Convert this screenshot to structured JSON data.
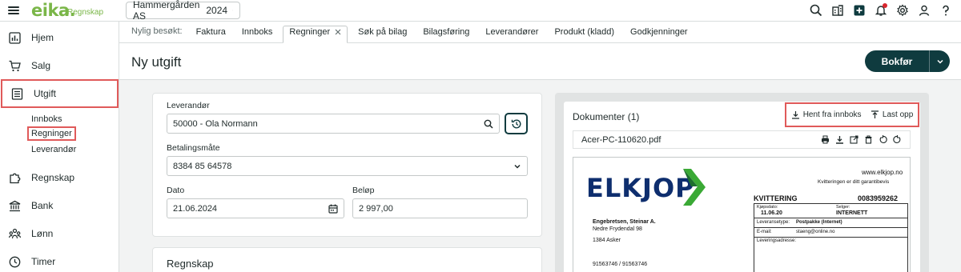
{
  "topbar": {
    "logo": "eika.",
    "logo_sub": "Regnskap",
    "company": "Hammergården AS",
    "year": "2024"
  },
  "sidebar": {
    "items": [
      {
        "label": "Hjem",
        "icon": "chart-icon"
      },
      {
        "label": "Salg",
        "icon": "cart-icon"
      },
      {
        "label": "Utgift",
        "icon": "list-doc-icon"
      },
      {
        "label": "Regnskap",
        "icon": "puzzle-icon"
      },
      {
        "label": "Bank",
        "icon": "bank-icon"
      },
      {
        "label": "Lønn",
        "icon": "people-icon"
      },
      {
        "label": "Timer",
        "icon": "clock-icon"
      }
    ],
    "subitems": [
      "Innboks",
      "Regninger",
      "Leverandør"
    ]
  },
  "tabs": {
    "recent_label": "Nylig besøkt:",
    "items": [
      "Faktura",
      "Innboks",
      "Regninger",
      "Søk på bilag",
      "Bilagsføring",
      "Leverandører",
      "Produkt (kladd)",
      "Godkjenninger"
    ]
  },
  "page": {
    "title": "Ny utgift",
    "bokfor": "Bokfør"
  },
  "form": {
    "supplier_label": "Leverandør",
    "supplier_value": "50000 - Ola Normann",
    "payment_label": "Betalingsmåte",
    "payment_value": "8384 85 64578",
    "date_label": "Dato",
    "date_value": "21.06.2024",
    "amount_label": "Beløp",
    "amount_value": "2 997,00"
  },
  "regnskap_section": "Regnskap",
  "documents": {
    "title": "Dokumenter (1)",
    "fetch_inbox": "Hent fra innboks",
    "upload": "Last opp",
    "file_name": "Acer-PC-110620.pdf"
  },
  "receipt": {
    "brand": "ELKJOP",
    "website": "www.elkjop.no",
    "guarantee": "Kvitteringen er ditt garantibevis",
    "kvittering": "KVITTERING",
    "receipt_no": "0083959262",
    "kjopsdato_label": "Kjøpsdato:",
    "kjopsdato": "11.06.20",
    "selger_label": "Selger:",
    "selger": "INTERNETT",
    "leveransetype_label": "Leveransetype:",
    "leveransetype": "Postpakke (Internet)",
    "email_label": "E-mail:",
    "email": "staeng@online.no",
    "leveringsadresse_label": "Leveringsadresse:",
    "customer_name": "Engebretsen, Steinar A.",
    "customer_street": "Nedre Frydendal 98",
    "customer_city": "1384 Asker",
    "customer_phone": "91563746 / 91563746"
  }
}
